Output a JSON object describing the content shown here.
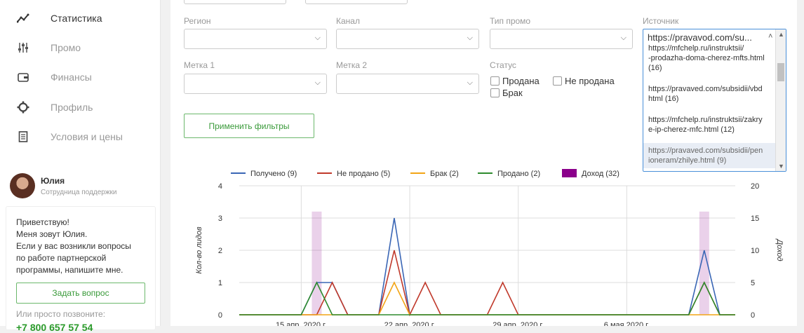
{
  "sidebar": {
    "items": [
      {
        "label": "Статистика",
        "icon": "chart-line-icon"
      },
      {
        "label": "Промо",
        "icon": "sliders-icon"
      },
      {
        "label": "Финансы",
        "icon": "wallet-icon"
      },
      {
        "label": "Профиль",
        "icon": "gear-icon"
      },
      {
        "label": "Условия и цены",
        "icon": "document-icon"
      }
    ],
    "user": {
      "name": "Юлия",
      "role": "Сотрудница поддержки"
    },
    "chat": {
      "lines": [
        "Приветствую!",
        "Меня зовут Юлия.",
        "Если у вас возникли вопросы",
        "по работе партнерской",
        "программы, напишите мне."
      ],
      "ask_button": "Задать вопрос",
      "call_text": "Или просто позвоните:",
      "phone": "+7 800 657 57 54"
    }
  },
  "filters": {
    "region_label": "Регион",
    "channel_label": "Канал",
    "promo_type_label": "Тип промо",
    "source_label": "Источник",
    "tag1_label": "Метка 1",
    "tag2_label": "Метка 2",
    "status_label": "Статус",
    "status_options": [
      "Продана",
      "Не продана",
      "Брак"
    ],
    "apply_button": "Применить фильтры",
    "source_selected": "https://pravavod.com/su...",
    "source_options": [
      {
        "lines": [
          "https://mfchelp.ru/instruktsii/",
          "-prodazha-doma-cherez-mfts.html",
          "(16)"
        ]
      },
      {
        "lines": [
          "https://pravaved.com/subsidii/vbd",
          "html (16)"
        ]
      },
      {
        "lines": [
          "https://mfchelp.ru/instruktsii/zakry",
          "e-ip-cherez-mfc.html (12)"
        ]
      },
      {
        "lines": [
          "https://pravaved.com/subsidii/pen",
          "ioneram/zhilye.html (9)"
        ]
      }
    ]
  },
  "colors": {
    "received": "#3a66b5",
    "not_sold": "#c0392b",
    "defect": "#f2a516",
    "sold": "#2e8b2e",
    "income": "#8b008b",
    "accent": "#3a9a3a"
  },
  "chart_data": {
    "type": "line",
    "legend": [
      "Получено (9)",
      "Не продано (5)",
      "Брак (2)",
      "Продано (2)",
      "Доход (32)"
    ],
    "ylabel": "Кол-во лидов",
    "y2label": "Доход",
    "yticks": [
      "0",
      "1",
      "2",
      "3",
      "4"
    ],
    "y2ticks": [
      "0",
      "5",
      "10",
      "15",
      "20"
    ],
    "ylim": [
      0,
      4
    ],
    "y2lim": [
      0,
      20
    ],
    "xticks": [
      "15 апр. 2020 г.",
      "22 апр. 2020 г.",
      "29 апр. 2020 г.",
      "6 мая 2020 г."
    ],
    "xtick_days": [
      4,
      11,
      18,
      25
    ],
    "x_days": [
      0,
      1,
      2,
      3,
      4,
      5,
      6,
      7,
      8,
      9,
      10,
      11,
      12,
      13,
      14,
      15,
      16,
      17,
      18,
      19,
      20,
      21,
      22,
      23,
      24,
      25,
      26,
      27,
      28,
      29,
      30,
      31,
      32
    ],
    "series": [
      {
        "key": "received",
        "values": [
          0,
          0,
          0,
          0,
          0,
          1,
          1,
          0,
          0,
          0,
          3,
          0,
          0,
          0,
          0,
          0,
          0,
          0,
          0,
          0,
          0,
          0,
          0,
          0,
          0,
          0,
          0,
          0,
          0,
          0,
          2,
          0,
          0
        ]
      },
      {
        "key": "not_sold",
        "values": [
          0,
          0,
          0,
          0,
          0,
          0,
          1,
          0,
          0,
          0,
          2,
          0,
          1,
          0,
          0,
          0,
          0,
          1,
          0,
          0,
          0,
          0,
          0,
          0,
          0,
          0,
          0,
          0,
          0,
          0,
          1,
          0,
          0
        ]
      },
      {
        "key": "defect",
        "values": [
          0,
          0,
          0,
          0,
          0,
          0,
          0,
          0,
          0,
          0,
          1,
          0,
          0,
          0,
          0,
          0,
          0,
          0,
          0,
          0,
          0,
          0,
          0,
          0,
          0,
          0,
          0,
          0,
          0,
          0,
          0,
          0,
          0
        ]
      },
      {
        "key": "sold",
        "values": [
          0,
          0,
          0,
          0,
          0,
          1,
          0,
          0,
          0,
          0,
          0,
          0,
          0,
          0,
          0,
          0,
          0,
          0,
          0,
          0,
          0,
          0,
          0,
          0,
          0,
          0,
          0,
          0,
          0,
          0,
          1,
          0,
          0
        ]
      }
    ],
    "income_bars": [
      {
        "x": 5,
        "value": 16
      },
      {
        "x": 30,
        "value": 16
      }
    ]
  }
}
